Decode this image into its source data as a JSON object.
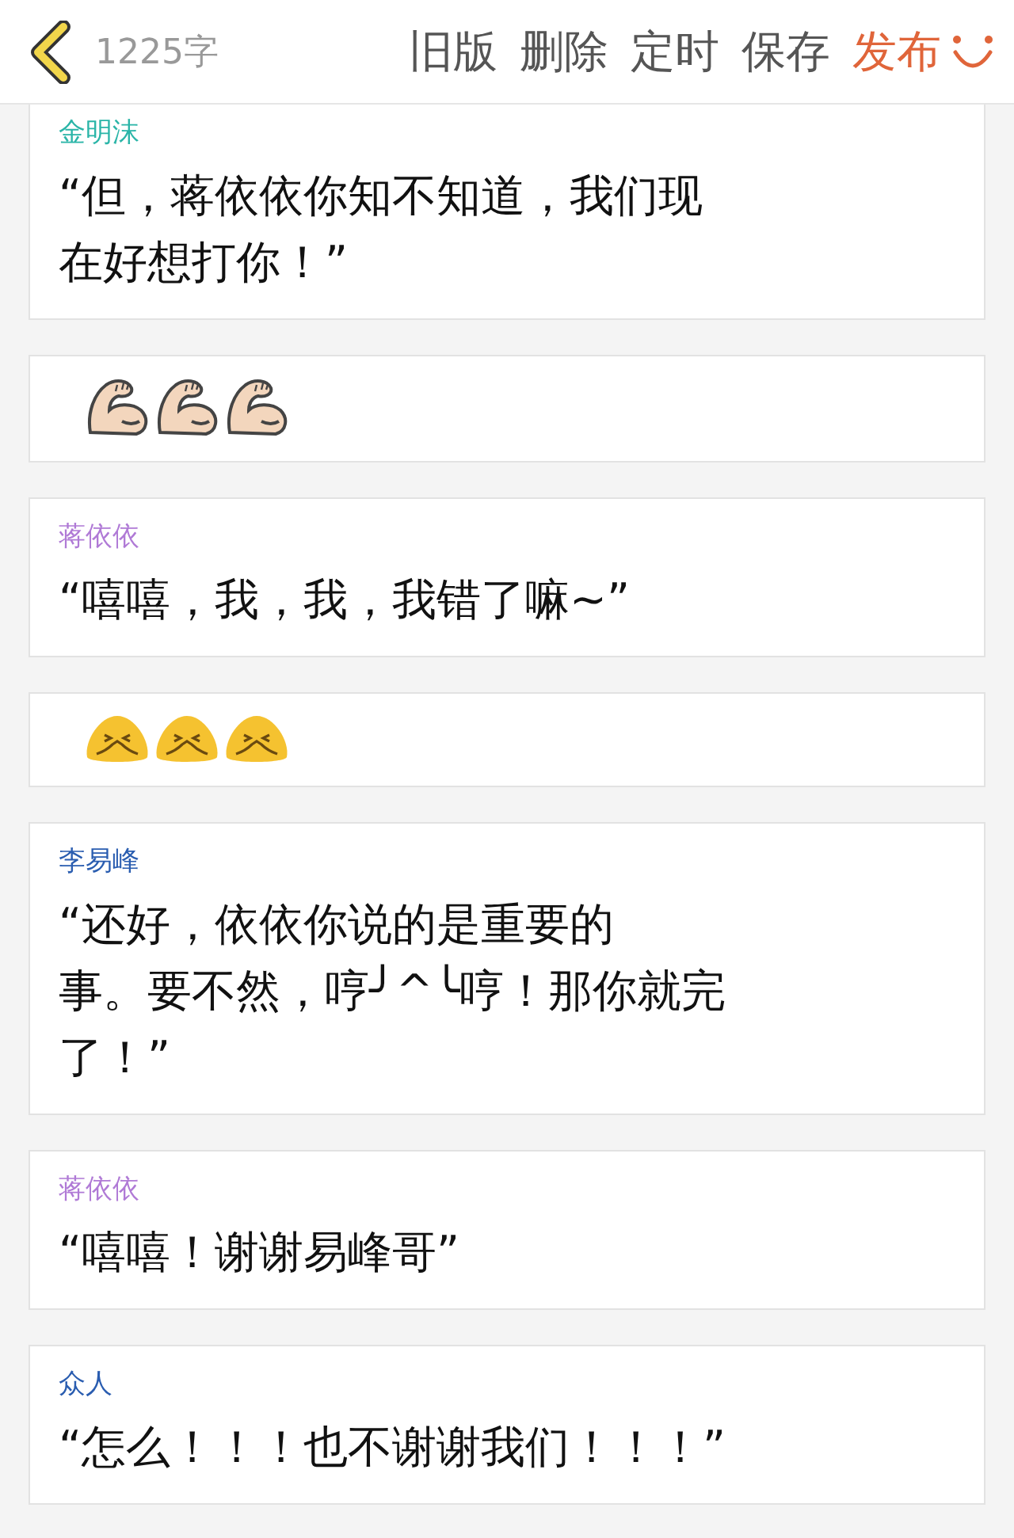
{
  "toolbar": {
    "word_count": "1225字",
    "actions": [
      {
        "label": "旧版",
        "kind": "normal"
      },
      {
        "label": "删除",
        "kind": "normal"
      },
      {
        "label": "定时",
        "kind": "normal"
      },
      {
        "label": "保存",
        "kind": "normal"
      },
      {
        "label": "发布",
        "kind": "primary"
      }
    ]
  },
  "cards": [
    {
      "kind": "dialogue",
      "speaker": "金明沫",
      "color": "#2bb5a8",
      "lines": [
        "“但，蒋依依你知不知道，我们现",
        "在好想打你！”"
      ]
    },
    {
      "kind": "emoji",
      "emojis": [
        {
          "kind": "muscle"
        },
        {
          "kind": "muscle"
        },
        {
          "kind": "muscle"
        }
      ]
    },
    {
      "kind": "dialogue",
      "speaker": "蒋依依",
      "color": "#b07ad6",
      "lines": [
        "“嘻嘻，我，我，我错了嘛~”"
      ]
    },
    {
      "kind": "emoji",
      "emojis": [
        {
          "kind": "pleading"
        },
        {
          "kind": "pleading"
        },
        {
          "kind": "pleading"
        }
      ]
    },
    {
      "kind": "dialogue",
      "speaker": "李易峰",
      "color": "#2a5db0",
      "lines": [
        "“还好，依依你说的是重要的",
        "事。要不然，哼╯^╰哼！那你就完",
        "了！”"
      ]
    },
    {
      "kind": "dialogue",
      "speaker": "蒋依依",
      "color": "#b07ad6",
      "lines": [
        "“嘻嘻！谢谢易峰哥”"
      ]
    },
    {
      "kind": "dialogue",
      "speaker": "众人",
      "color": "#2a5db0",
      "lines": [
        "“怎么！！！也不谢谢我们！！！”"
      ]
    }
  ]
}
